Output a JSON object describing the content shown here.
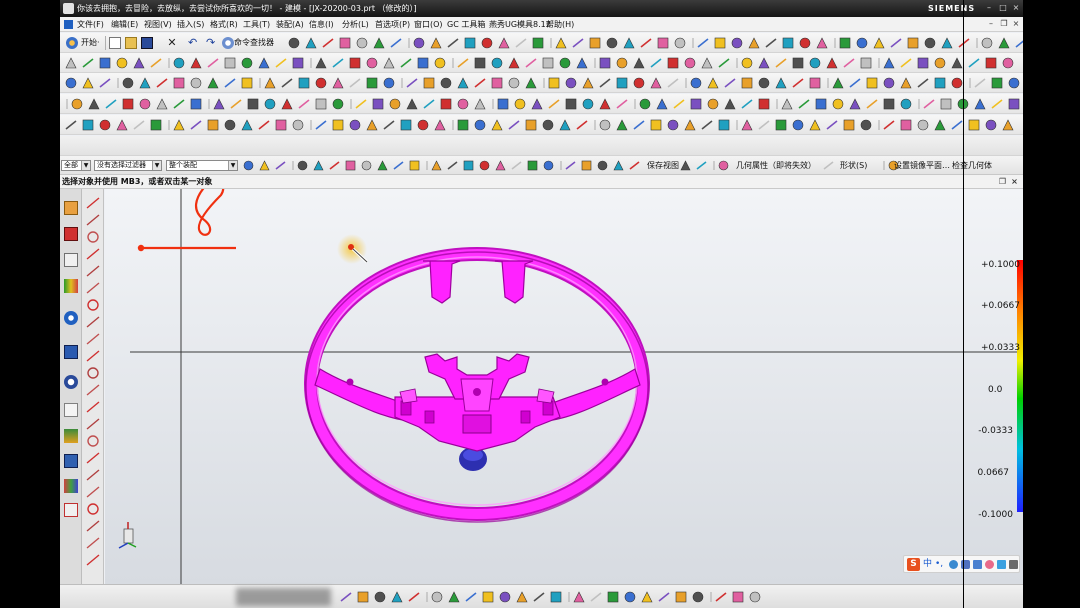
{
  "titlebar": {
    "title": "你该去拥抱，去冒险，去放纵，去尝试你所喜欢的一切！ - 建模 - [JX-20200-03.prt （修改的）]",
    "brand": "SIEMENS"
  },
  "menubar": {
    "items": [
      "文件(F)",
      "编辑(E)",
      "视图(V)",
      "插入(S)",
      "格式(R)",
      "工具(T)",
      "装配(A)",
      "信息(I)",
      "分析(L)",
      "首选项(P)",
      "窗口(O)",
      "GC 工具箱",
      "燕秀UG模具8.12",
      "帮助(H)"
    ]
  },
  "toolbar1": {
    "start_label": "开始·",
    "cmd_finder_label": "命令查找器"
  },
  "selection_bar": {
    "filter_type": "全部",
    "selection_filter": "没有选择过滤器",
    "scope": "整个装配",
    "save_view_label": "保存视图",
    "geometry_props_label": "几何属性（即将失效）",
    "shape_label": "形状(S)",
    "mirror_plane_label": "设置镜像平面…",
    "check_geometry_label": "检查几何体"
  },
  "cue_line": {
    "text": "选择对象并使用 MB3，或者双击某一对象"
  },
  "viewport": {
    "model_color": "#ff22ff",
    "scale_labels": [
      "+0.1000",
      "+0.0667",
      "+0.0333",
      "0.0",
      "-0.0333",
      "0.0667",
      "-0.1000"
    ]
  },
  "ime": {
    "logo": "S",
    "mode_label": "中",
    "punct_label": "•,"
  },
  "colors": {
    "titlebar_bg": "#1e1e1e",
    "viewport_top": "#f2f4f7",
    "annotation_red": "#f03010",
    "cursor_highlight": "#f0c020"
  }
}
